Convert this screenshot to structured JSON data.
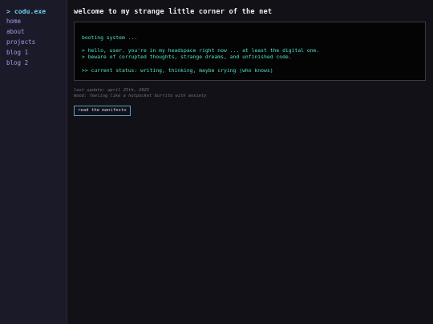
{
  "sidebar": {
    "brand_chevron": ">",
    "brand": "codu.exe",
    "items": [
      {
        "label": "home"
      },
      {
        "label": "about"
      },
      {
        "label": "projects"
      },
      {
        "label": "blog 1"
      },
      {
        "label": "blog 2"
      }
    ]
  },
  "main": {
    "title": "welcome to my strange little corner of the net",
    "terminal": {
      "boot": "booting system ...",
      "lines": [
        "> hello, user. you're in my headspace right now ... at least the digital one.",
        "> beware of corrupted thoughts, strange dreams, and unfinished code."
      ],
      "status": ">> current status: writing, thinking, maybe crying (who knows)"
    },
    "last_update": "last update: april 25th, 2025",
    "mood": "mood: feeling like a hotpocket burrito with anxiety",
    "manifesto_button": "read the manifesto"
  },
  "colors": {
    "background": "#121117",
    "sidebar": "#1b1a29",
    "accent": "#6fd3f0",
    "terminal_text": "#4fe3c9",
    "nav_link": "#9aa0e6"
  }
}
